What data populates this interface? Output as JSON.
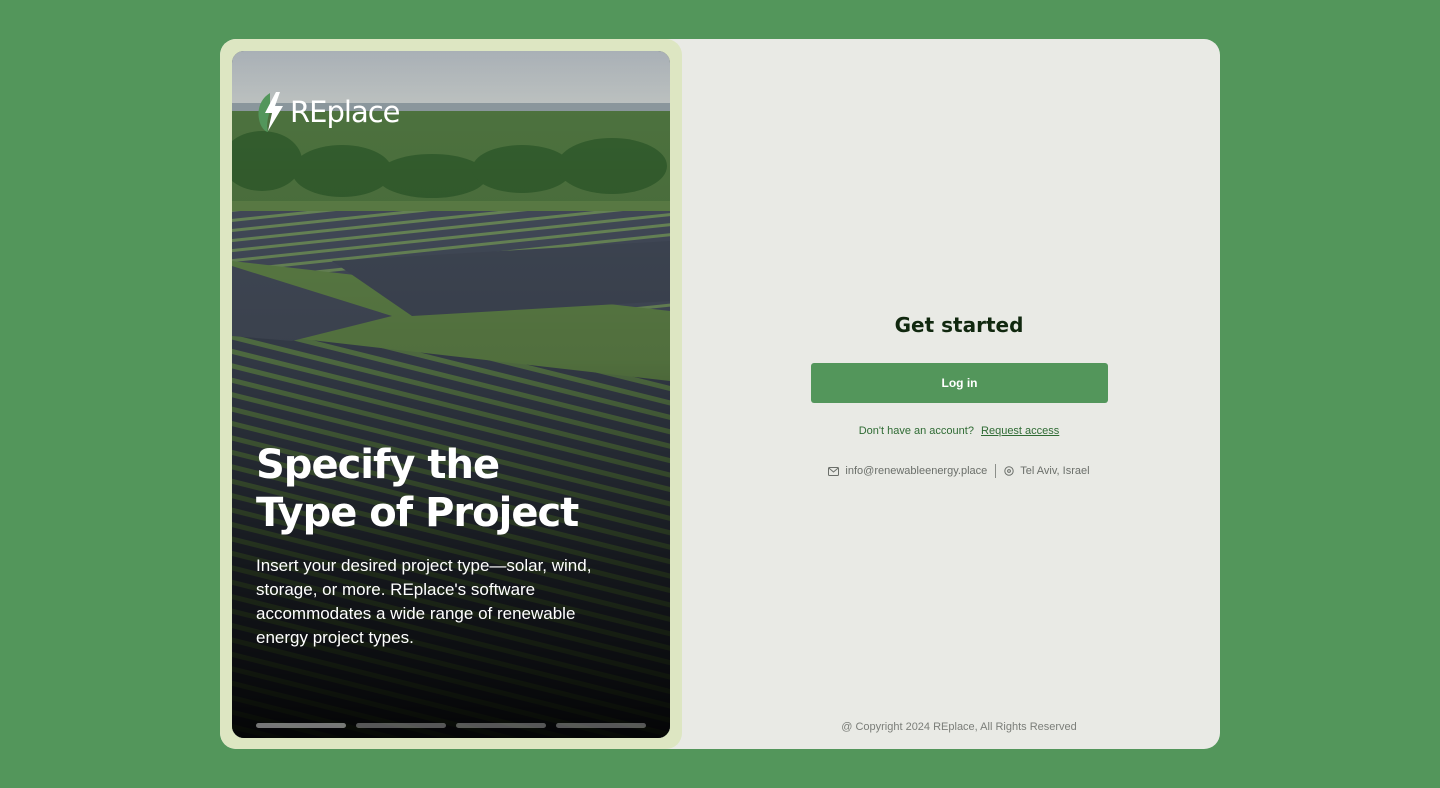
{
  "brand": {
    "logo_text": "REplace",
    "logo_icon": "lightning-leaf-icon"
  },
  "hero": {
    "title_line1": "Specify the",
    "title_line2": "Type of Project",
    "description": "Insert your desired project type—solar, wind, storage, or more. REplace's software accommodates a wide range of renewable energy project types.",
    "slides_total": 4,
    "slide_active": 1
  },
  "auth": {
    "heading": "Get started",
    "login_label": "Log in",
    "no_account_text": "Don't have an account?",
    "request_access_label": "Request access"
  },
  "contact": {
    "email": "info@renewableenergy.place",
    "email_icon": "mail-icon",
    "location": "Tel Aviv, Israel",
    "location_icon": "location-pin-icon"
  },
  "footer": {
    "copyright": "@ Copyright 2024 REplace, All Rights Reserved"
  },
  "colors": {
    "page_bg": "#53965b",
    "accent": "#53965b",
    "card_bg": "#e9eae5",
    "hero_frame": "#dde6c2",
    "heading": "#11280f",
    "link": "#2f6b34"
  }
}
